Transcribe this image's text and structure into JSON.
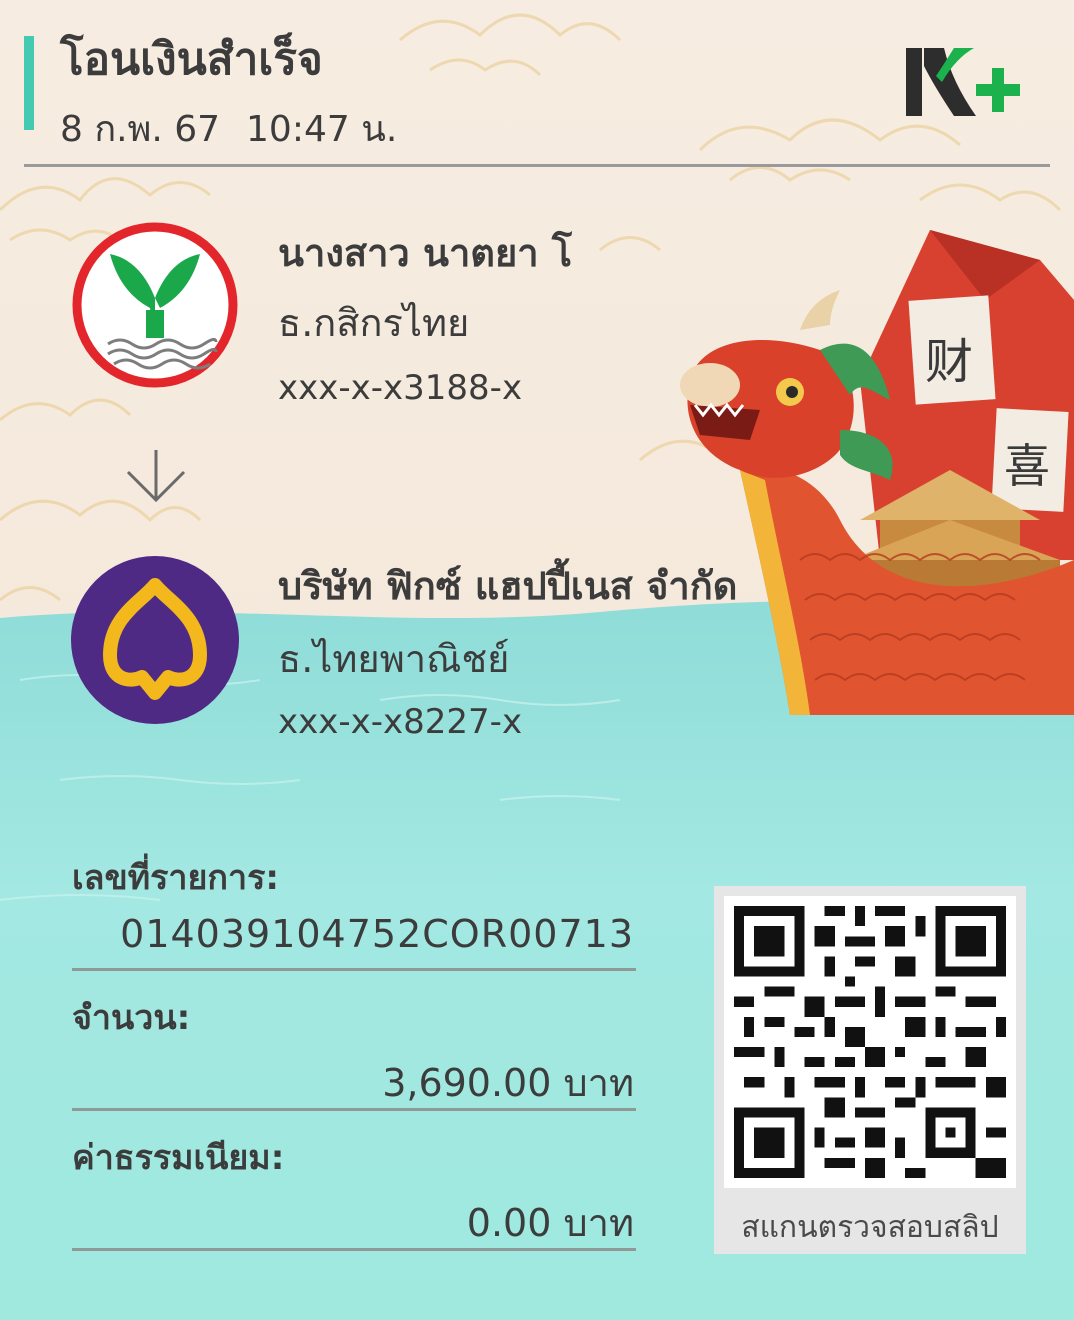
{
  "header": {
    "title": "โอนเงินสำเร็จ",
    "date": "8 ก.พ. 67",
    "time": "10:47 น.",
    "brand_logo": "K+"
  },
  "sender": {
    "name": "นางสาว นาตยา โ",
    "bank": "ธ.กสิกรไทย",
    "account": "xxx-x-x3188-x",
    "logo_icon": "kasikorn-bank-logo"
  },
  "transfer_arrow_icon": "arrow-down-icon",
  "receiver": {
    "name": "บริษัท ฟิกซ์ แฮปปี้เนส จำกัด",
    "bank": "ธ.ไทยพาณิชย์",
    "account": "xxx-x-x8227-x",
    "logo_icon": "scb-bank-logo"
  },
  "details": {
    "reference_label": "เลขที่รายการ:",
    "reference_value": "014039104752COR00713",
    "amount_label": "จำนวน:",
    "amount_value": "3,690.00 บาท",
    "fee_label": "ค่าธรรมเนียม:",
    "fee_value": "0.00 บาท"
  },
  "qr": {
    "caption": "สแกนตรวจสอบสลิป",
    "icon": "qr-code-icon"
  },
  "colors": {
    "accent": "#44c9b3",
    "kbank_green": "#1ba84a",
    "kbank_red": "#e3262b",
    "scb_purple": "#4e2a84",
    "scb_gold": "#f2b81c",
    "sea": "#9ee6df",
    "paper": "#f6ece1"
  }
}
